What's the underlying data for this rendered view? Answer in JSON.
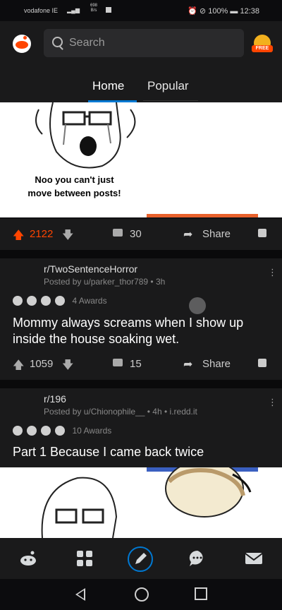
{
  "status_bar": {
    "carrier": "vodafone IE",
    "network_rate": "698\nB/s",
    "battery": "100%",
    "time": "12:38"
  },
  "search": {
    "placeholder": "Search"
  },
  "coin": {
    "label": "FREE"
  },
  "tabs": [
    {
      "label": "Home"
    },
    {
      "label": "Popular"
    }
  ],
  "post1": {
    "image_caption": "Noo you can't just move between posts!",
    "score": "2122",
    "comments": "30",
    "share": "Share"
  },
  "post2": {
    "subreddit": "r/TwoSentenceHorror",
    "meta": "Posted by u/parker_thor789 • 3h",
    "awards": "4 Awards",
    "title": "Mommy always screams when I show up inside the house soaking wet.",
    "score": "1059",
    "comments": "15",
    "share": "Share"
  },
  "post3": {
    "subreddit": "r/196",
    "meta": "Posted by u/Chionophile__ • 4h • i.redd.it",
    "awards": "10 Awards",
    "title": "Part 1 Because I came back twice"
  },
  "colors": {
    "upvote": "#ff4500",
    "accent": "#0079d3"
  },
  "icons": [
    "reddit-logo-icon",
    "search-icon",
    "coin-icon",
    "upvote-icon",
    "downvote-icon",
    "comment-icon",
    "share-icon",
    "save-icon",
    "more-options-icon",
    "home-icon",
    "communities-icon",
    "create-post-icon",
    "chat-icon",
    "inbox-icon"
  ]
}
